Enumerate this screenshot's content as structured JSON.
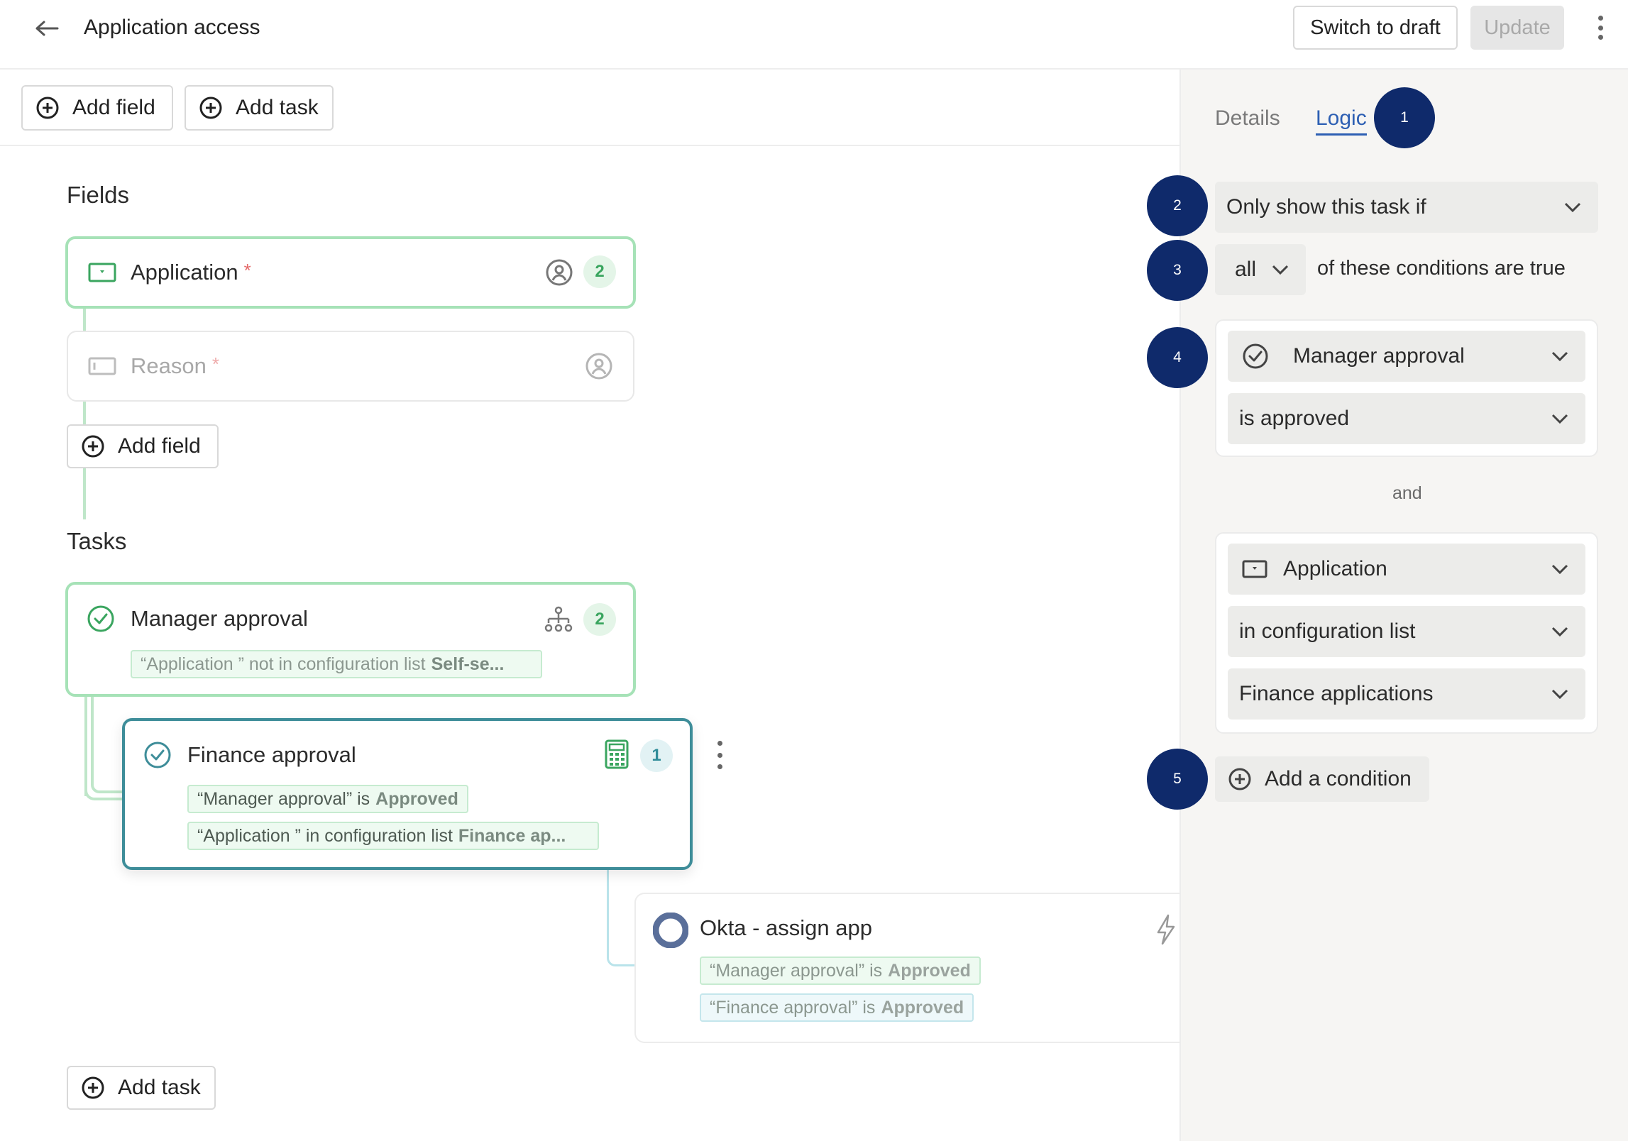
{
  "header": {
    "title": "Application access",
    "switch_to_draft": "Switch to draft",
    "update": "Update"
  },
  "toolbar": {
    "add_field": "Add field",
    "add_task": "Add task"
  },
  "fields": {
    "heading": "Fields",
    "items": [
      {
        "label": "Application",
        "required_mark": "*",
        "assignee_count": "2"
      },
      {
        "label": "Reason",
        "required_mark": "*"
      }
    ],
    "add_button": "Add field"
  },
  "tasks": {
    "heading": "Tasks",
    "items": [
      {
        "title": "Manager approval",
        "count": "2",
        "conditions": [
          {
            "text": "“Application ” not in configuration list",
            "value": "Self-se..."
          }
        ]
      },
      {
        "title": "Finance approval",
        "count": "1",
        "conditions": [
          {
            "text": "“Manager approval” is",
            "value": "Approved"
          },
          {
            "text": "“Application ” in configuration list",
            "value": "Finance ap..."
          }
        ]
      },
      {
        "title": "Okta - assign app",
        "conditions": [
          {
            "text": "“Manager approval” is",
            "value": "Approved"
          },
          {
            "text": "“Finance approval” is",
            "value": "Approved"
          }
        ]
      }
    ],
    "add_button": "Add task"
  },
  "panel": {
    "tabs": [
      {
        "label": "Details",
        "active": false
      },
      {
        "label": "Logic",
        "active": true
      }
    ],
    "visibility_rule": "Only show this task if",
    "quantifier": "all",
    "quantifier_suffix": "of these conditions are true",
    "conditions": [
      {
        "subject": "Manager approval",
        "operator": "is approved"
      },
      {
        "subject": "Application",
        "operator": "in configuration list",
        "value": "Finance applications"
      }
    ],
    "joiner": "and",
    "add_condition": "Add a condition"
  },
  "steps": [
    "1",
    "2",
    "3",
    "4",
    "5"
  ],
  "colors": {
    "accent_green": "#a6e2b7",
    "accent_teal": "#3e8d99",
    "step_navy": "#0f2a6b",
    "link_blue": "#2d5fb3"
  }
}
